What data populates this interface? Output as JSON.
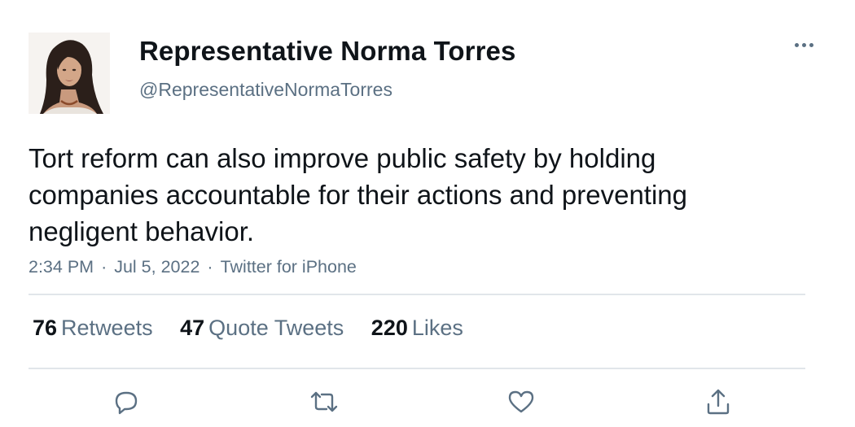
{
  "tweet": {
    "author": {
      "display_name": "Representative Norma Torres",
      "handle": "@RepresentativeNormaTorres",
      "avatar": "profile-photo"
    },
    "text": "Tort reform can also improve public safety by holding companies accountable for their actions and preventing negligent behavior.",
    "meta": {
      "time": "2:34 PM",
      "separator": "·",
      "date": "Jul 5, 2022",
      "source": "Twitter for iPhone"
    },
    "stats": {
      "retweets": {
        "count": "76",
        "label": "Retweets"
      },
      "quotes": {
        "count": "47",
        "label": "Quote Tweets"
      },
      "likes": {
        "count": "220",
        "label": "Likes"
      }
    },
    "actions": [
      "reply-icon",
      "retweet-icon",
      "like-icon",
      "share-icon"
    ],
    "colors": {
      "text_primary": "#0f1419",
      "text_secondary": "#5b7083",
      "divider": "#e1e6ea"
    }
  }
}
